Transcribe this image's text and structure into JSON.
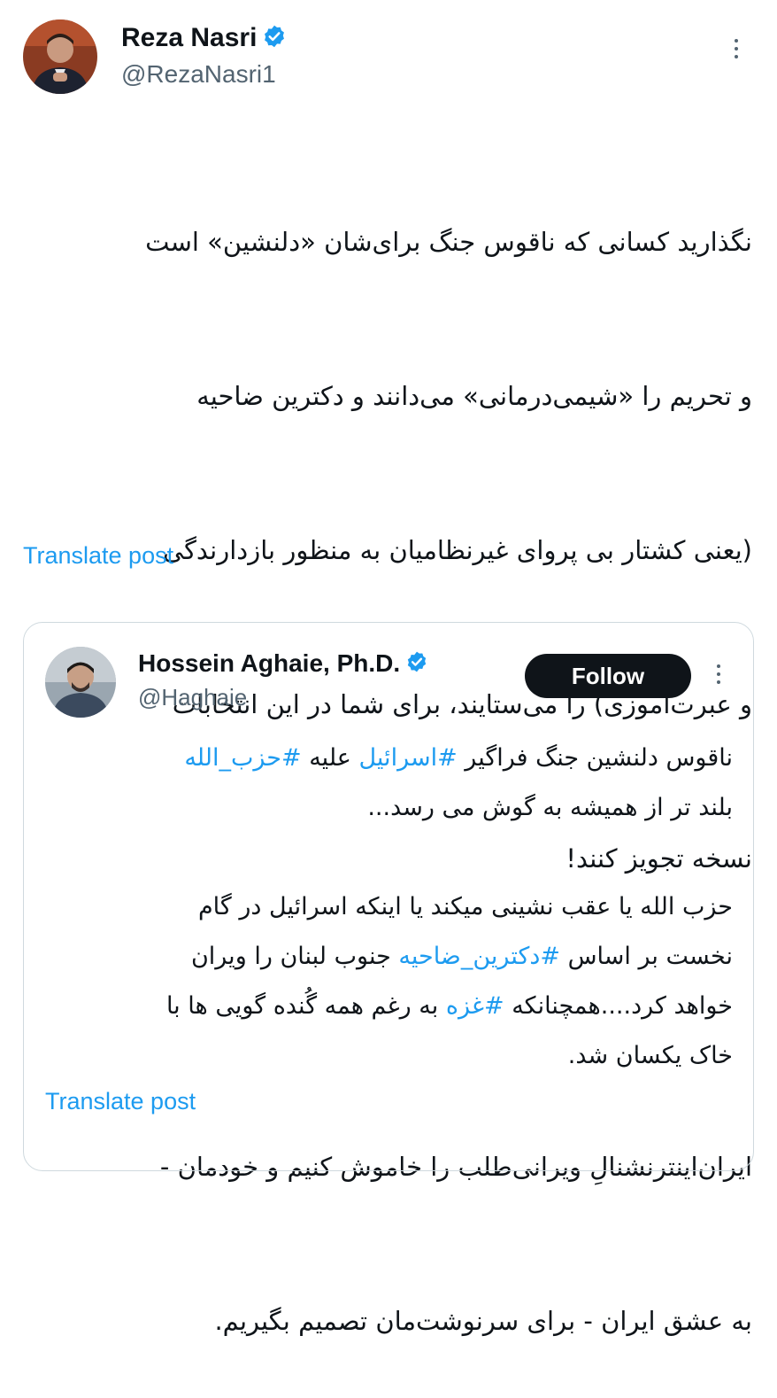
{
  "main_post": {
    "author": {
      "display_name": "Reza Nasri",
      "handle": "@RezaNasri1",
      "verified": true,
      "avatar_icon": "person-avatar"
    },
    "text_lines": [
      "نگذارید کسانی که ناقوس جنگ برای‌شان «دلنشین» است",
      "و تحریم را «شیمی‌درمانی» می‌دانند و دکترین ضاحیه",
      "(یعنی کشتار بی پروای غیرنظامیان به منظور بازدارندگی",
      "و عبرت‌آموزی) را می‌ستایند، برای شما در این انتخابات",
      "نسخه تجویز کنند!",
      "",
      "ایران‌اینترنشنالِ ویرانی‌طلب را خاموش کنیم و خودمان -",
      "به عشق ایران - برای سرنوشت‌مان تصمیم بگیریم."
    ],
    "translate_label": "Translate post",
    "more_icon": "more-vertical-icon"
  },
  "quoted_post": {
    "author": {
      "display_name": "Hossein Aghaie, Ph.D.",
      "handle": "@Haghaie",
      "verified": true,
      "avatar_icon": "person-avatar"
    },
    "follow_label": "Follow",
    "text_lines": [
      [
        {
          "text": "ناقوس دلنشین جنگ فراگیر ",
          "hashtag": false
        },
        {
          "text": "#اسرائیل",
          "hashtag": true
        },
        {
          "text": " علیه ",
          "hashtag": false
        },
        {
          "text": "#حزب_الله",
          "hashtag": true
        }
      ],
      [
        {
          "text": "بلند تر از همیشه به گوش می رسد...",
          "hashtag": false
        }
      ],
      [
        {
          "text": "",
          "hashtag": false
        }
      ],
      [
        {
          "text": "حزب الله یا عقب نشینی میکند یا اینکه اسرائیل در گام",
          "hashtag": false
        }
      ],
      [
        {
          "text": "نخست بر اساس ",
          "hashtag": false
        },
        {
          "text": "#دکترین_ضاحیه",
          "hashtag": true
        },
        {
          "text": " جنوب لبنان را ویران",
          "hashtag": false
        }
      ],
      [
        {
          "text": "خواهد کرد....همچنانکه ",
          "hashtag": false
        },
        {
          "text": "#غزه",
          "hashtag": true
        },
        {
          "text": " به رغم همه گُنده گویی ها با",
          "hashtag": false
        }
      ],
      [
        {
          "text": "خاک یکسان شد.",
          "hashtag": false
        }
      ]
    ],
    "translate_label": "Translate post",
    "more_icon": "more-vertical-icon"
  },
  "colors": {
    "accent": "#1d9bf0",
    "text": "#0f1419",
    "secondary_text": "#536471",
    "border": "#cfd9de",
    "follow_button_bg": "#0f1419"
  }
}
